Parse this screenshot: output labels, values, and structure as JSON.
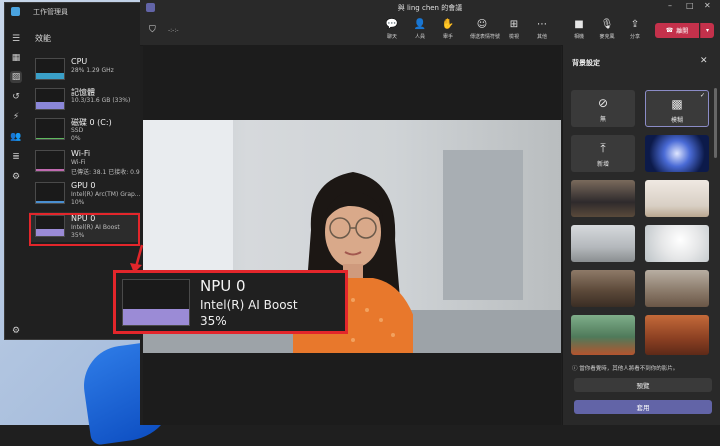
{
  "task_manager": {
    "title": "工作管理員",
    "section": "效能",
    "items": [
      {
        "name": "CPU",
        "detail": "28% 1.29 GHz",
        "detail2": ""
      },
      {
        "name": "記憶體",
        "detail": "10.3/31.6 GB (33%)",
        "detail2": ""
      },
      {
        "name": "磁碟 0 (C:)",
        "detail": "SSD",
        "detail2": "0%"
      },
      {
        "name": "Wi-Fi",
        "detail": "Wi-Fi",
        "detail2": "已傳送: 38.1 已接收: 0.9"
      },
      {
        "name": "GPU 0",
        "detail": "Intel(R) Arc(TM) Grap...",
        "detail2": "10%"
      },
      {
        "name": "NPU 0",
        "detail": "Intel(R) AI Boost",
        "detail2": "35%"
      }
    ],
    "npu_usage": 35
  },
  "zoom_callout": {
    "name": "NPU 0",
    "detail": "Intel(R) AI Boost",
    "percent": "35%"
  },
  "teams": {
    "title": "與 ling chen 的會議",
    "timer": "-:-:-",
    "toolbar": [
      {
        "icon": "chat-icon",
        "glyph": "💬",
        "label": "聊天"
      },
      {
        "icon": "people-icon",
        "glyph": "👤",
        "label": "人員"
      },
      {
        "icon": "raise-hand-icon",
        "glyph": "✋",
        "label": "舉手"
      },
      {
        "icon": "reaction-icon",
        "glyph": "☺",
        "label": "傳送表情符號"
      },
      {
        "icon": "view-icon",
        "glyph": "⊞",
        "label": "檢視"
      },
      {
        "icon": "more-icon",
        "glyph": "⋯",
        "label": "其他"
      },
      {
        "icon": "camera-icon",
        "glyph": "■",
        "label": "相機"
      },
      {
        "icon": "mic-icon",
        "glyph": "🎙",
        "label": "麥克風"
      },
      {
        "icon": "share-icon",
        "glyph": "⇪",
        "label": "分享"
      }
    ],
    "leave_label": "離開"
  },
  "background_panel": {
    "title": "背景設定",
    "none_label": "無",
    "blur_label": "模糊",
    "add_label": "新增",
    "note": "當你看覺時，其他人將看不到你的影片。",
    "preview_label": "預覽",
    "apply_label": "套用"
  },
  "colors": {
    "accent": "#6264a7",
    "leave": "#c4314b",
    "highlight": "#e3262b",
    "npu_graph": "#9b8bd6"
  }
}
